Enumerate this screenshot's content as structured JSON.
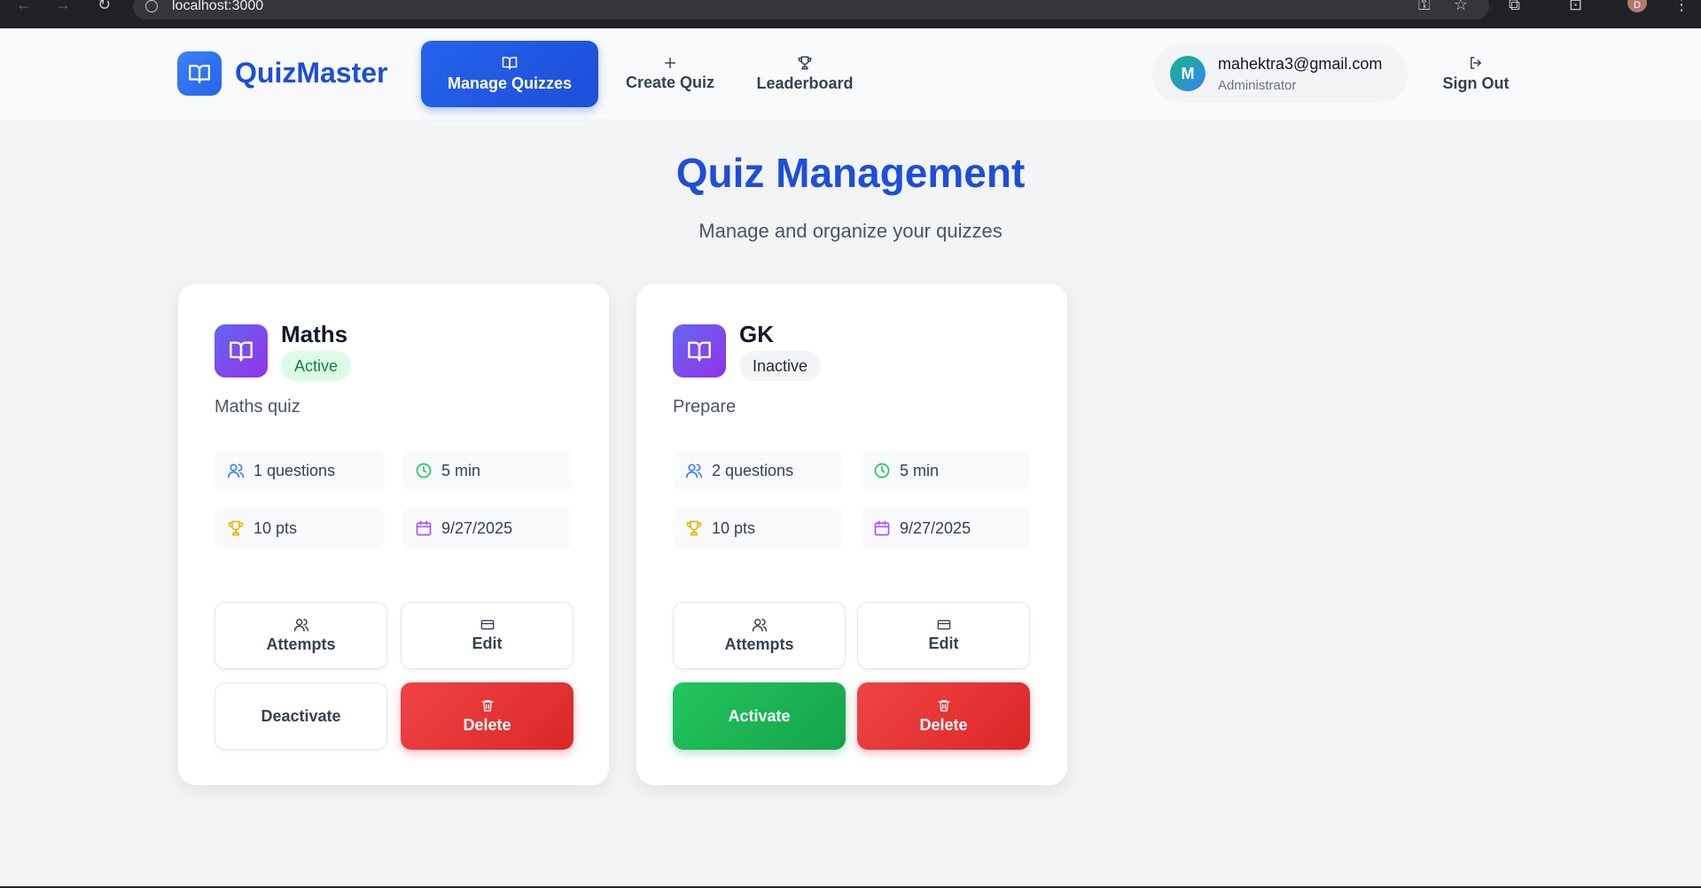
{
  "browser": {
    "url": "localhost:3000",
    "profile_initial": "D"
  },
  "app": {
    "name": "QuizMaster",
    "nav": [
      {
        "label": "Manage Quizzes",
        "icon": "book-icon",
        "active": true
      },
      {
        "label": "Create Quiz",
        "icon": "plus-icon",
        "active": false
      },
      {
        "label": "Leaderboard",
        "icon": "trophy-icon",
        "active": false
      }
    ],
    "user": {
      "initial": "M",
      "email": "mahektra3@gmail.com",
      "role": "Administrator"
    },
    "sign_out": "Sign Out"
  },
  "page": {
    "title": "Quiz Management",
    "subtitle": "Manage and organize your quizzes"
  },
  "quizzes": [
    {
      "title": "Maths",
      "status": "Active",
      "description": "Maths quiz",
      "questions": "1 questions",
      "duration": "5 min",
      "points": "10 pts",
      "date": "9/27/2025",
      "attempts_label": "Attempts",
      "edit_label": "Edit",
      "toggle_label": "Deactivate",
      "delete_label": "Delete"
    },
    {
      "title": "GK",
      "status": "Inactive",
      "description": "Prepare",
      "questions": "2 questions",
      "duration": "5 min",
      "points": "10 pts",
      "date": "9/27/2025",
      "attempts_label": "Attempts",
      "edit_label": "Edit",
      "toggle_label": "Activate",
      "delete_label": "Delete"
    }
  ],
  "colors": {
    "brand": "#1d4ed8",
    "active_badge": "#dcfce7",
    "delete": "#dc2626",
    "activate": "#16a34a",
    "quiz_icon": "#7c3aed"
  }
}
